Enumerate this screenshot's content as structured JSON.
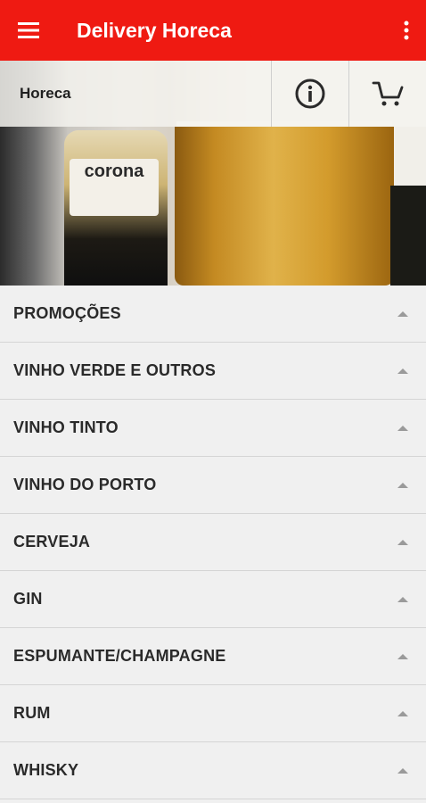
{
  "appbar": {
    "title": "Delivery Horeca",
    "menu_icon": "hamburger-menu-icon",
    "more_icon": "more-vertical-icon",
    "color": "#ef1a12"
  },
  "hero": {
    "brand_label": "Horeca",
    "bottle_text": "corona",
    "info_icon": "info-icon",
    "cart_icon": "cart-icon"
  },
  "categories": [
    {
      "label": "PROMOÇÕES"
    },
    {
      "label": "VINHO VERDE E OUTROS"
    },
    {
      "label": "VINHO TINTO"
    },
    {
      "label": "VINHO DO PORTO"
    },
    {
      "label": "CERVEJA"
    },
    {
      "label": "GIN"
    },
    {
      "label": "ESPUMANTE/CHAMPAGNE"
    },
    {
      "label": "RUM"
    },
    {
      "label": "WHISKY"
    }
  ]
}
